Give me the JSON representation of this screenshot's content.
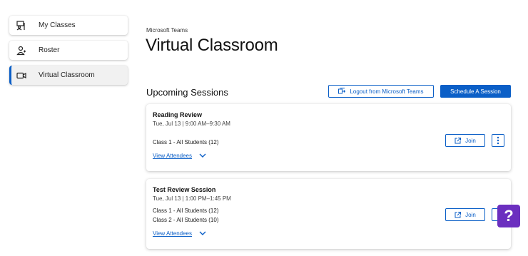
{
  "sidebar": {
    "items": [
      {
        "label": "My Classes",
        "icon": "classes-icon"
      },
      {
        "label": "Roster",
        "icon": "roster-icon"
      },
      {
        "label": "Virtual Classroom",
        "icon": "video-camera-icon",
        "active": true
      }
    ]
  },
  "header": {
    "eyebrow": "Microsoft Teams",
    "title": "Virtual Classroom"
  },
  "sessions": {
    "heading": "Upcoming Sessions",
    "logout_label": "Logout from Microsoft Teams",
    "schedule_label": "Schedule A Session",
    "items": [
      {
        "title": "Reading Review",
        "time": "Tue, Jul 13 | 9:00 AM–9:30 AM",
        "classes": [
          "Class 1 - All Students (12)"
        ],
        "attendees_label": "View Attendees",
        "join_label": "Join"
      },
      {
        "title": "Test Review Session",
        "time": "Tue, Jul 13 | 1:00 PM–1:45 PM",
        "classes": [
          "Class 1 - All Students (12)",
          "Class 2 - All Students (10)"
        ],
        "attendees_label": "View Attendees",
        "join_label": "Join"
      }
    ]
  },
  "help": {
    "label": "?"
  },
  "colors": {
    "accent": "#0b5fc7",
    "help": "#6b2fbf"
  }
}
